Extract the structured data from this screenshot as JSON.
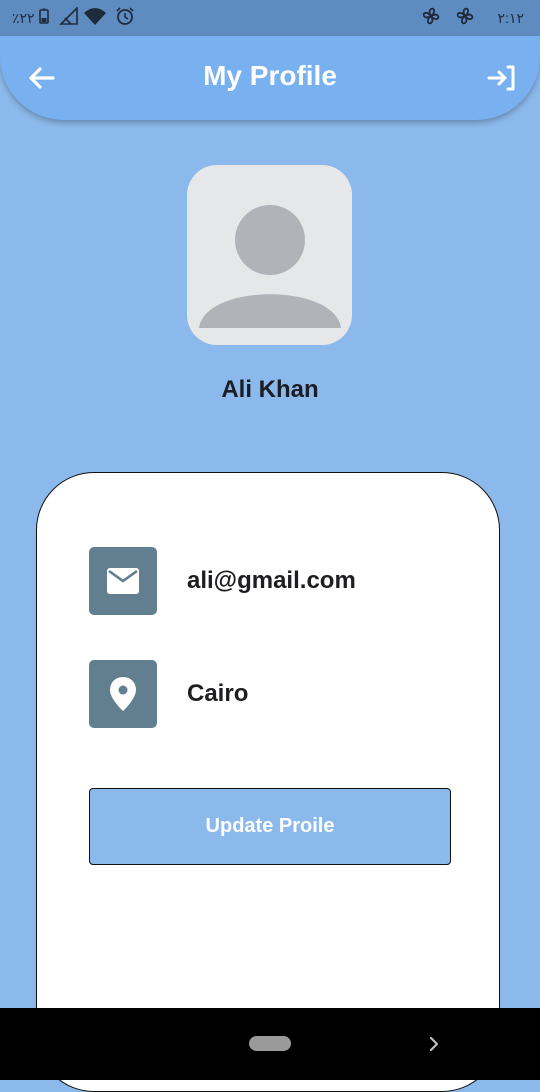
{
  "status_bar": {
    "battery_text": "٪٢٢",
    "time": "٢:١٢",
    "icons": [
      "battery-icon",
      "no-signal-icon",
      "wifi-icon",
      "alarm-icon",
      "fan-icon",
      "fan-icon"
    ]
  },
  "app_bar": {
    "title": "My Profile",
    "back_icon": "arrow-left-icon",
    "logout_icon": "logout-icon"
  },
  "profile": {
    "name": "Ali Khan",
    "avatar_icon": "person-placeholder-icon"
  },
  "details": {
    "email": "ali@gmail.com",
    "email_icon": "email-icon",
    "location": "Cairo",
    "location_icon": "location-pin-icon"
  },
  "actions": {
    "update_label": "Update Proile"
  },
  "nav": {
    "home_icon": "home-pill-icon",
    "recents_icon": "chevron-right-icon"
  },
  "colors": {
    "background": "#8cb9eb",
    "app_bar": "#79b0f0",
    "icon_tile": "#627f8f",
    "card": "#ffffff"
  }
}
